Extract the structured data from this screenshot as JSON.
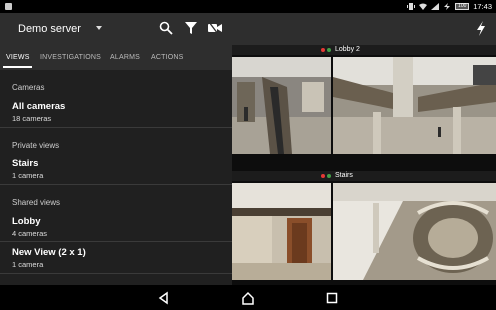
{
  "status_bar": {
    "time": "17:43",
    "battery": "100"
  },
  "app_bar": {
    "server_name": "Demo server"
  },
  "tabs": [
    {
      "label": "VIEWS",
      "active": true
    },
    {
      "label": "INVESTIGATIONS",
      "active": false
    },
    {
      "label": "ALARMS",
      "active": false
    },
    {
      "label": "ACTIONS",
      "active": false
    }
  ],
  "sections": {
    "cameras": "Cameras",
    "private_views": "Private views",
    "shared_views": "Shared views"
  },
  "items": {
    "all_cameras": {
      "title": "All cameras",
      "sub": "18 cameras"
    },
    "stairs": {
      "title": "Stairs",
      "sub": "1 camera"
    },
    "lobby": {
      "title": "Lobby",
      "sub": "4 cameras"
    },
    "new_view": {
      "title": "New View (2 x 1)",
      "sub": "1 camera"
    }
  },
  "views": {
    "lobby_label": "Lobby 2",
    "stairs_label": "Stairs"
  },
  "colors": {
    "accent": "#ffffff",
    "panel": "#2e2e2e",
    "list_bg": "#202020"
  }
}
